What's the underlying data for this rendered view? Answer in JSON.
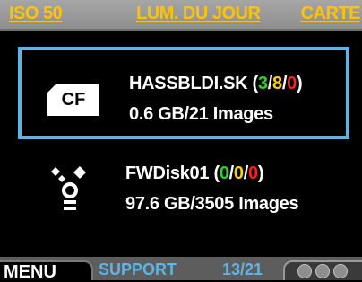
{
  "top_bar": {
    "iso": "ISO 50",
    "white_balance": "LUM. DU JOUR",
    "storage": "CARTE"
  },
  "storages": [
    {
      "icon": "cf-card-icon",
      "icon_label": "CF",
      "name": "HASSBLDI.SK",
      "counts": {
        "open": "(",
        "green": "3",
        "sep1": "/",
        "yellow": "8",
        "sep2": "/",
        "red": "0",
        "close": ")"
      },
      "info": "0.6 GB/21 Images",
      "selected": true
    },
    {
      "icon": "firewire-icon",
      "name": "FWDisk01",
      "counts": {
        "open": "(",
        "green": "0",
        "sep1": "/",
        "yellow": "0",
        "sep2": "/",
        "red": "0",
        "close": ")"
      },
      "info": "97.6 GB/3505 Images",
      "selected": false
    }
  ],
  "bottom_bar": {
    "menu_label": "MENU",
    "support_label": "SUPPORT",
    "page_counter": "13/21"
  },
  "colors": {
    "accent_yellow": "#ffc400",
    "selection_blue": "#5fb4e3",
    "status_green": "#2fd12f",
    "status_yellow": "#ffd200",
    "status_red": "#ff2020"
  }
}
